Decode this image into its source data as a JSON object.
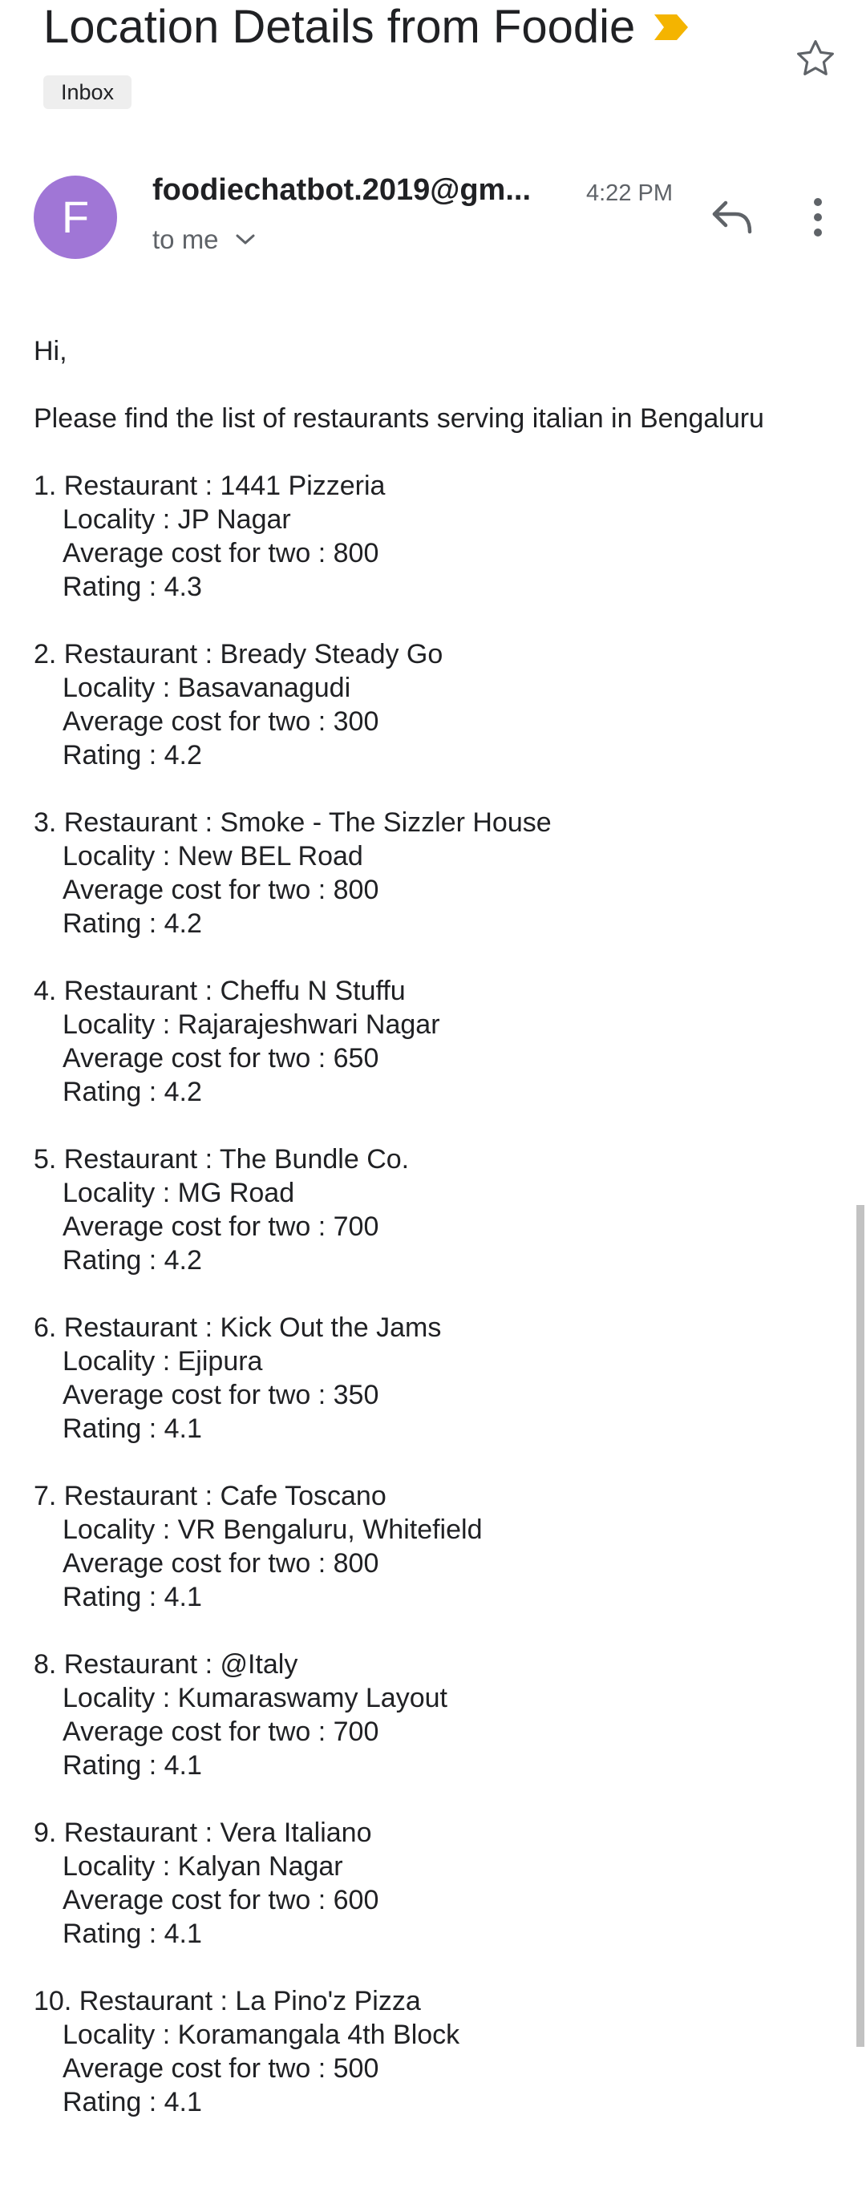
{
  "email": {
    "subject": "Location Details from Foodie",
    "label": "Inbox",
    "sender_initial": "F",
    "sender": "foodiechatbot.2019@gm...",
    "time": "4:22 PM",
    "to": "to me"
  },
  "body": {
    "greeting": "Hi,",
    "intro": "Please find the list of restaurants serving italian in Bengaluru",
    "restaurants": [
      {
        "name": "1. Restaurant : 1441 Pizzeria",
        "locality": "Locality : JP Nagar",
        "cost": "Average cost for two : 800",
        "rating": "Rating : 4.3"
      },
      {
        "name": "2. Restaurant : Bready Steady Go",
        "locality": "Locality : Basavanagudi",
        "cost": "Average cost for two : 300",
        "rating": "Rating : 4.2"
      },
      {
        "name": "3. Restaurant : Smoke - The Sizzler House",
        "locality": "Locality : New BEL Road",
        "cost": "Average cost for two : 800",
        "rating": "Rating : 4.2"
      },
      {
        "name": "4. Restaurant : Cheffu N Stuffu",
        "locality": "Locality : Rajarajeshwari Nagar",
        "cost": "Average cost for two : 650",
        "rating": "Rating : 4.2"
      },
      {
        "name": "5. Restaurant : The Bundle Co.",
        "locality": "Locality : MG Road",
        "cost": "Average cost for two : 700",
        "rating": "Rating : 4.2"
      },
      {
        "name": "6. Restaurant : Kick Out the Jams",
        "locality": "Locality : Ejipura",
        "cost": "Average cost for two : 350",
        "rating": "Rating : 4.1"
      },
      {
        "name": "7. Restaurant : Cafe Toscano",
        "locality": "Locality : VR Bengaluru, Whitefield",
        "cost": "Average cost for two : 800",
        "rating": "Rating : 4.1"
      },
      {
        "name": "8. Restaurant : @Italy",
        "locality": "Locality : Kumaraswamy Layout",
        "cost": "Average cost for two : 700",
        "rating": "Rating : 4.1"
      },
      {
        "name": "9. Restaurant : Vera Italiano",
        "locality": "Locality : Kalyan Nagar",
        "cost": "Average cost for two : 600",
        "rating": "Rating : 4.1"
      },
      {
        "name": "10. Restaurant : La Pino'z Pizza",
        "locality": "Locality : Koramangala 4th Block",
        "cost": "Average cost for two : 500",
        "rating": "Rating : 4.1"
      }
    ]
  },
  "icons": {
    "importance": "importance-marker-icon",
    "star": "star-outline-icon",
    "reply": "reply-icon",
    "more": "more-vertical-icon",
    "expand": "chevron-down-icon"
  },
  "colors": {
    "avatar": "#a076d6",
    "importance": "#f4b400",
    "secondary_text": "#5f6368",
    "scrollbar": "#c2c2c2"
  }
}
